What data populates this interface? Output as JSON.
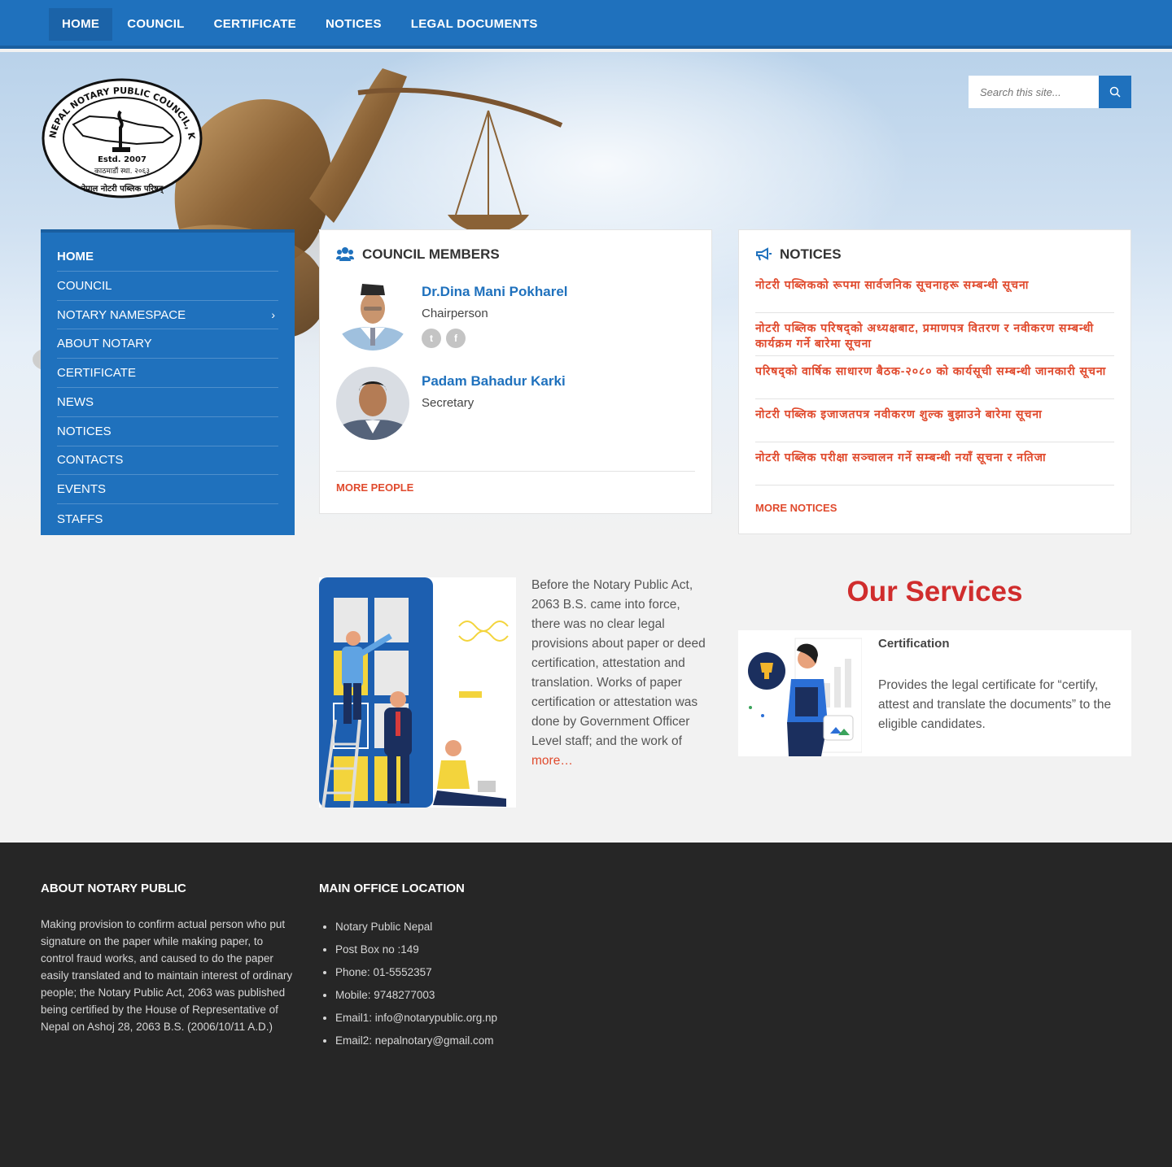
{
  "topnav": {
    "items": [
      "HOME",
      "COUNCIL",
      "CERTIFICATE",
      "NOTICES",
      "LEGAL DOCUMENTS"
    ]
  },
  "logo": {
    "text_top": "NEPAL NOTARY PUBLIC COUNCIL, KATHMANDU",
    "text_estd": "Estd. 2007",
    "text_ne1": "काठमाडौं स्था. २०६३",
    "text_ne2": "नेपाल नोटरी पब्लिक परिषद्"
  },
  "search": {
    "placeholder": "Search this site..."
  },
  "sidebar": {
    "items": [
      {
        "label": "HOME"
      },
      {
        "label": "COUNCIL"
      },
      {
        "label": "NOTARY NAMESPACE",
        "chevron": "›"
      },
      {
        "label": "ABOUT NOTARY"
      },
      {
        "label": "CERTIFICATE"
      },
      {
        "label": "NEWS"
      },
      {
        "label": "NOTICES"
      },
      {
        "label": "CONTACTS"
      },
      {
        "label": "EVENTS"
      },
      {
        "label": "STAFFS"
      }
    ]
  },
  "council": {
    "title": "COUNCIL MEMBERS",
    "members": [
      {
        "name": "Dr.Dina Mani Pokharel",
        "role": "Chairperson"
      },
      {
        "name": "Padam Bahadur Karki",
        "role": "Secretary"
      }
    ],
    "more": "MORE PEOPLE"
  },
  "notices": {
    "title": "NOTICES",
    "items": [
      "नोटरी पब्लिकको रूपमा सार्वजनिक सूचनाहरू सम्बन्धी सूचना",
      "नोटरी पब्लिक परिषद्को अध्यक्षबाट, प्रमाणपत्र वितरण र नवीकरण सम्बन्धी कार्यक्रम गर्ने बारेमा सूचना",
      "परिषद्को वार्षिक साधारण बैठक-२०८० को कार्यसूची सम्बन्धी जानकारी सूचना",
      "नोटरी पब्लिक इजाजतपत्र नवीकरण शुल्क बुझाउने बारेमा सूचना",
      "नोटरी पब्लिक परीक्षा सञ्चालन गर्ने सम्बन्धी नयाँ सूचना र नतिजा"
    ],
    "more": "MORE NOTICES"
  },
  "intro": {
    "text": "Before the Notary Public Act, 2063 B.S. came into force, there was no clear legal provisions about paper or deed certification, attestation and translation. Works of paper certification or attestation was done by Government Officer Level staff; and the work of",
    "more": "more…"
  },
  "services": {
    "title": "Our Services",
    "card": {
      "title": "Certification",
      "desc": "Provides the legal certificate for “certify, attest and translate the documents” to the eligible candidates."
    }
  },
  "footer": {
    "about_title": "ABOUT NOTARY PUBLIC",
    "about_text": "Making provision to confirm actual person who put signature on the paper while making paper, to control fraud works, and caused to do the paper easily translated and to maintain interest of ordinary people; the Notary Public Act, 2063 was published being certified by the House of Representative of Nepal on Ashoj 28, 2063 B.S. (2006/10/11 A.D.)",
    "loc_title": "MAIN OFFICE LOCATION",
    "loc_items": [
      "Notary Public Nepal",
      "Post Box no :149",
      "Phone: 01-5552357",
      "Mobile: 9748277003",
      "Email1: info@notarypublic.org.np",
      "Email2: nepalnotary@gmail.com"
    ]
  },
  "colors": {
    "primary": "#1f71bd",
    "accent": "#e04a2d",
    "services_title": "#d02d2d",
    "footer_bg": "#262626"
  },
  "icons": [
    "search-icon",
    "users-icon",
    "megaphone-icon",
    "twitter-icon",
    "facebook-icon",
    "chevron-right-icon"
  ]
}
